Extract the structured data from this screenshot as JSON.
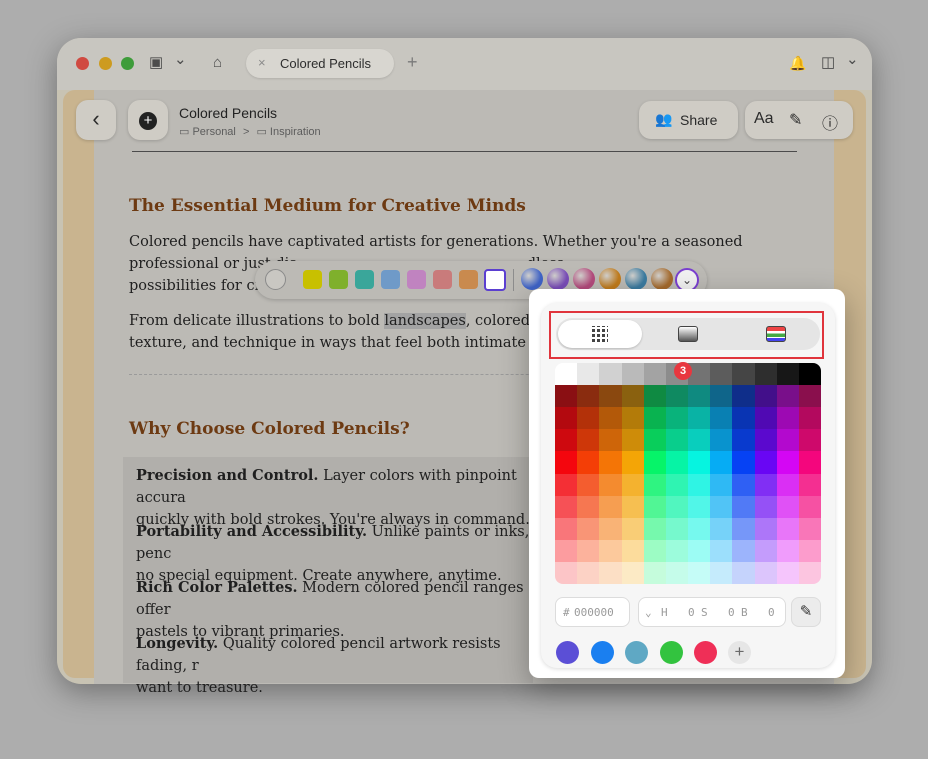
{
  "titlebar": {
    "sidebar_icon": "▣",
    "chevron_icon": "⌄",
    "home_icon": "⌂",
    "tab_close": "×",
    "tab_title": "Colored Pencils",
    "new_tab": "+",
    "bell_icon": "🔔",
    "panel_icon": "◫"
  },
  "toolbar": {
    "back_icon": "‹",
    "add_icon": "+",
    "doc_title": "Colored Pencils",
    "breadcrumb_1": "Personal",
    "breadcrumb_sep": ">",
    "breadcrumb_2": "Inspiration",
    "share_icon": "👥",
    "share_label": "Share",
    "font_label": "Aa",
    "highlighter_icon": "✎",
    "info_icon": "ⓘ"
  },
  "document": {
    "heading_1": "The Essential Medium for Creative Minds",
    "p1_line1": "Colored pencils have captivated artists for generations. Whether you're a seasoned",
    "p1_line2": "professional or just dis",
    "p1_line2_end": "dless",
    "p1_line3": "possibilities for cre",
    "p2_line1_a": "From delicate illustrations to bold ",
    "p2_line1_hl": "landscapes",
    "p2_line1_b": ", colored penc",
    "p2_line2": "texture, and technique in ways that feel both intimate and r",
    "heading_2": "Why Choose Colored Pencils?",
    "c1_bold": "Precision and Control.",
    "c1_text": " Layer colors with pinpoint accura",
    "c1_line2": "quickly with bold strokes. You're always in command.",
    "c2_bold": "Portability and Accessibility.",
    "c2_text": " Unlike paints or inks, penc",
    "c2_line2": "no special equipment. Create anywhere, anytime.",
    "c3_bold": "Rich Color Palettes.",
    "c3_text": " Modern colored pencil ranges offer",
    "c3_line2": "pastels to vibrant primaries.",
    "c4_bold": "Longevity.",
    "c4_text": " Quality colored pencil artwork resists fading, r",
    "c4_line2": "want to treasure."
  },
  "mini_palette": {
    "swatches": [
      "#c8c000",
      "#7fb02c",
      "#3aa69a",
      "#6f9ac8",
      "#c083c0",
      "#c97b7b",
      "#c98a4e"
    ],
    "gradient_dots": [
      "#3f63c6",
      "#7a4db8",
      "#b34a7c",
      "#c07b1c",
      "#3b7ba0",
      "#a56a2c"
    ]
  },
  "picker": {
    "tabs": [
      "grid",
      "spectrum",
      "sliders"
    ],
    "active_tab": "grid",
    "step_badge": "3",
    "hex_prefix": "#",
    "hex_value": "000000",
    "hsb_h_label": "H",
    "hsb_h_value": "0",
    "hsb_s_label": "S",
    "hsb_s_value": "0",
    "hsb_b_label": "B",
    "hsb_b_value": "0",
    "eyedropper_icon": "✎",
    "saved_colors": [
      "#5b4fd6",
      "#1a7ff0",
      "#5fa8c4",
      "#33c33f",
      "#ef2f57"
    ],
    "add_color_label": "+"
  }
}
